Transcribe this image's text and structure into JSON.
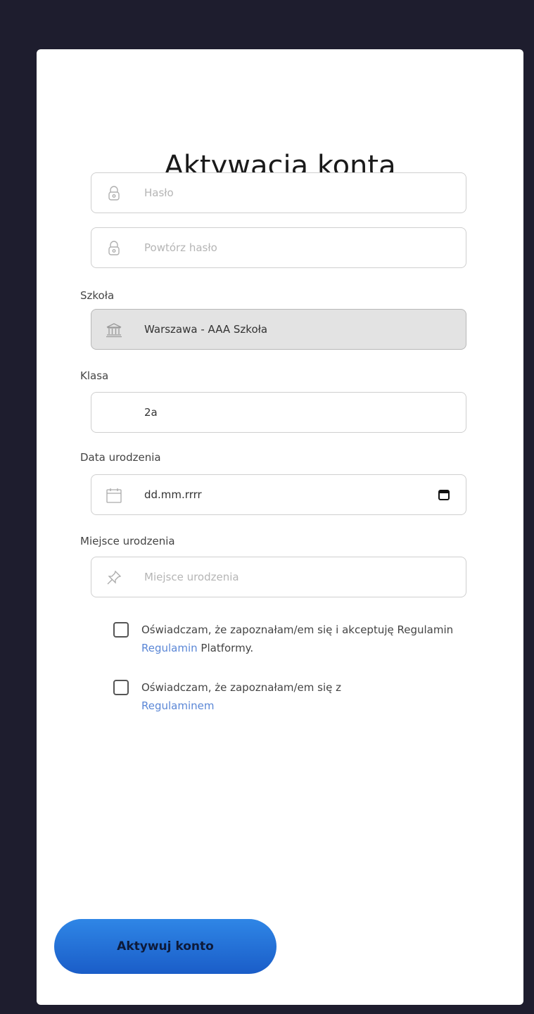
{
  "page": {
    "title": "Aktywacja konta"
  },
  "form": {
    "password": {
      "placeholder": "Hasło",
      "icon": "lock-icon"
    },
    "repeat_password": {
      "placeholder": "Powtórz hasło",
      "icon": "lock-icon"
    },
    "school": {
      "label": "Szkoła",
      "value": "Warszawa - AAA Szkoła",
      "icon": "institution-icon"
    },
    "class": {
      "label": "Klasa",
      "value": "2a"
    },
    "birth_date": {
      "label": "Data urodzenia",
      "placeholder": "dd.mm.rrrr",
      "icon": "calendar-icon"
    },
    "birth_place": {
      "label": "Miejsce urodzenia",
      "placeholder": "Miejsce urodzenia",
      "icon": "pin-icon"
    }
  },
  "consents": [
    {
      "text_before": "Oświadczam, że zapoznałam/em się i akceptuję Regulamin ",
      "link": "Regulamin",
      "text_after": " Platformy."
    },
    {
      "text_before": "Oświadczam, że zapoznałam/em się z ",
      "link": "Regulaminem",
      "text_after": ""
    }
  ],
  "actions": {
    "submit_label": "Aktywuj konto"
  },
  "colors": {
    "background": "#1e1d2e",
    "link": "#5b87d6",
    "button_gradient_top": "#2f86e6",
    "button_gradient_bottom": "#1a5dc8"
  }
}
